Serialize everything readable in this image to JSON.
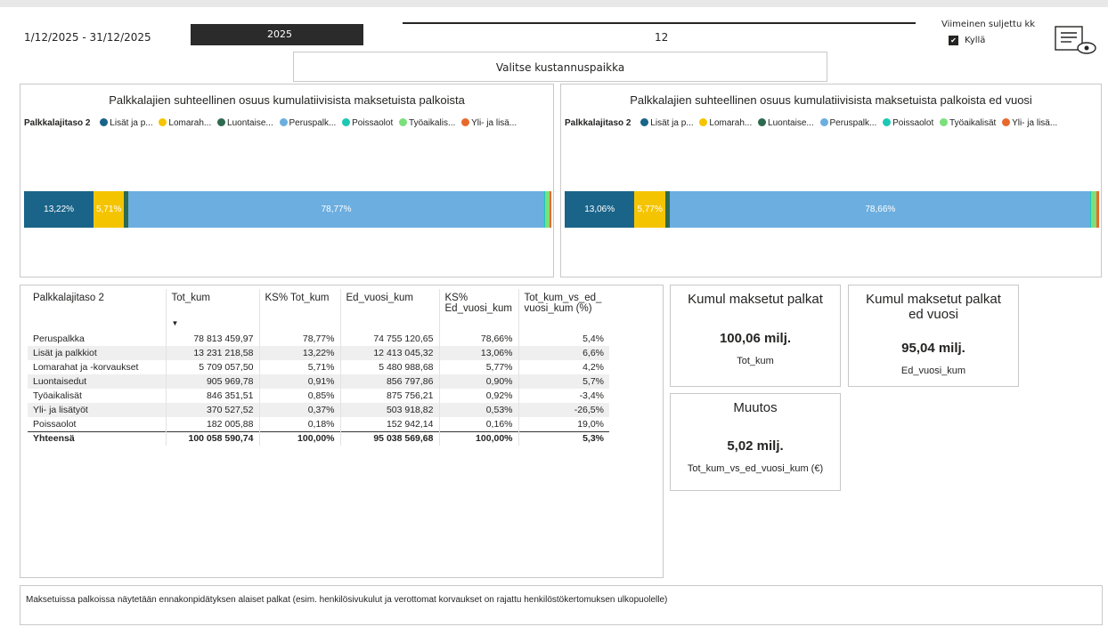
{
  "header": {
    "date_range": "1/12/2025 - 31/12/2025",
    "year": "2025",
    "month": "12",
    "closed_label": "Viimeinen suljettu kk",
    "closed_value": "Kyllä",
    "cost_center_button": "Valitse kustannuspaikka"
  },
  "charts": {
    "current": {
      "title": "Palkkalajien suhteellinen osuus kumulatiivisista maksetuista palkoista",
      "legend_title": "Palkkalajitaso 2",
      "legend": [
        {
          "label": "Lisät ja p...",
          "color": "#1f6f8b"
        },
        {
          "label": "Lomarah...",
          "color": "#f2c200"
        },
        {
          "label": "Luontaise...",
          "color": "#2d6a4f"
        },
        {
          "label": "Peruspalk...",
          "color": "#6caee0"
        },
        {
          "label": "Poissaolot",
          "color": "#1bc9b4"
        },
        {
          "label": "Työaikalis...",
          "color": "#7be07b"
        },
        {
          "label": "Yli- ja lisä...",
          "color": "#e8692c"
        }
      ]
    },
    "previous": {
      "title": "Palkkalajien suhteellinen osuus kumulatiivisista maksetuista palkoista ed vuosi",
      "legend_title": "Palkkalajitaso 2",
      "legend": [
        {
          "label": "Lisät ja p...",
          "color": "#1f6f8b"
        },
        {
          "label": "Lomarah...",
          "color": "#f2c200"
        },
        {
          "label": "Luontaise...",
          "color": "#2d6a4f"
        },
        {
          "label": "Peruspalk...",
          "color": "#6caee0"
        },
        {
          "label": "Poissaolot",
          "color": "#1bc9b4"
        },
        {
          "label": "Työaikalisät",
          "color": "#7be07b"
        },
        {
          "label": "Yli- ja lisä...",
          "color": "#e8692c"
        }
      ]
    }
  },
  "chart_data": [
    {
      "type": "bar",
      "title": "Palkkalajien suhteellinen osuus kumulatiivisista maksetuista palkoista",
      "series": [
        {
          "name": "Lisät ja palkkiot",
          "values": [
            13.22
          ],
          "label": "13,22%",
          "color": "#1a6489"
        },
        {
          "name": "Lomarahat ja -korvaukset",
          "values": [
            5.71
          ],
          "label": "5,71%",
          "color": "#f5c400"
        },
        {
          "name": "Luontaisedut",
          "values": [
            0.91
          ],
          "label": "",
          "color": "#2d6a4f"
        },
        {
          "name": "Peruspalkka",
          "values": [
            78.77
          ],
          "label": "78,77%",
          "color": "#6caee0"
        },
        {
          "name": "Poissaolot",
          "values": [
            0.18
          ],
          "label": "",
          "color": "#1bc9b4"
        },
        {
          "name": "Työaikalisät",
          "values": [
            0.85
          ],
          "label": "",
          "color": "#7be07b"
        },
        {
          "name": "Yli- ja lisätyöt",
          "values": [
            0.37
          ],
          "label": "",
          "color": "#e8692c"
        }
      ]
    },
    {
      "type": "bar",
      "title": "Palkkalajien suhteellinen osuus kumulatiivisista maksetuista palkoista ed vuosi",
      "series": [
        {
          "name": "Lisät ja palkkiot",
          "values": [
            13.06
          ],
          "label": "13,06%",
          "color": "#1a6489"
        },
        {
          "name": "Lomarahat ja -korvaukset",
          "values": [
            5.77
          ],
          "label": "5,77%",
          "color": "#f5c400"
        },
        {
          "name": "Luontaisedut",
          "values": [
            0.9
          ],
          "label": "",
          "color": "#2d6a4f"
        },
        {
          "name": "Peruspalkka",
          "values": [
            78.66
          ],
          "label": "78,66%",
          "color": "#6caee0"
        },
        {
          "name": "Poissaolot",
          "values": [
            0.16
          ],
          "label": "",
          "color": "#1bc9b4"
        },
        {
          "name": "Työaikalisät",
          "values": [
            0.92
          ],
          "label": "",
          "color": "#7be07b"
        },
        {
          "name": "Yli- ja lisätyöt",
          "values": [
            0.53
          ],
          "label": "",
          "color": "#e8692c"
        }
      ]
    }
  ],
  "table": {
    "headers": [
      "Palkkalajitaso 2",
      "Tot_kum",
      "KS% Tot_kum",
      "Ed_vuosi_kum",
      "KS% Ed_vuosi_kum",
      "Tot_kum_vs_ed_ vuosi_kum (%)"
    ],
    "rows": [
      [
        "Peruspalkka",
        "78 813 459,97",
        "78,77%",
        "74 755 120,65",
        "78,66%",
        "5,4%"
      ],
      [
        "Lisät ja palkkiot",
        "13 231 218,58",
        "13,22%",
        "12 413 045,32",
        "13,06%",
        "6,6%"
      ],
      [
        "Lomarahat ja -korvaukset",
        "5 709 057,50",
        "5,71%",
        "5 480 988,68",
        "5,77%",
        "4,2%"
      ],
      [
        "Luontaisedut",
        "905 969,78",
        "0,91%",
        "856 797,86",
        "0,90%",
        "5,7%"
      ],
      [
        "Työaikalisät",
        "846 351,51",
        "0,85%",
        "875 756,21",
        "0,92%",
        "-3,4%"
      ],
      [
        "Yli- ja lisätyöt",
        "370 527,52",
        "0,37%",
        "503 918,82",
        "0,53%",
        "-26,5%"
      ],
      [
        "Poissaolot",
        "182 005,88",
        "0,18%",
        "152 942,14",
        "0,16%",
        "19,0%"
      ]
    ],
    "total": [
      "Yhteensä",
      "100 058 590,74",
      "100,00%",
      "95 038 569,68",
      "100,00%",
      "5,3%"
    ]
  },
  "cards": {
    "cum_paid": {
      "title": "Kumul maksetut palkat",
      "value": "100,06 milj.",
      "sub": "Tot_kum"
    },
    "cum_paid_prev": {
      "title": "Kumul maksetut palkat ed vuosi",
      "value": "95,04 milj.",
      "sub": "Ed_vuosi_kum"
    },
    "change": {
      "title": "Muutos",
      "value": "5,02 milj.",
      "sub": "Tot_kum_vs_ed_vuosi_kum (€)"
    }
  },
  "footer_note": "Maksetuissa palkoissa näytetään ennakonpidätyksen alaiset palkat (esim. henkilösivukulut ja verottomat korvaukset on rajattu henkilöstökertomuksen ulkopuolelle)"
}
